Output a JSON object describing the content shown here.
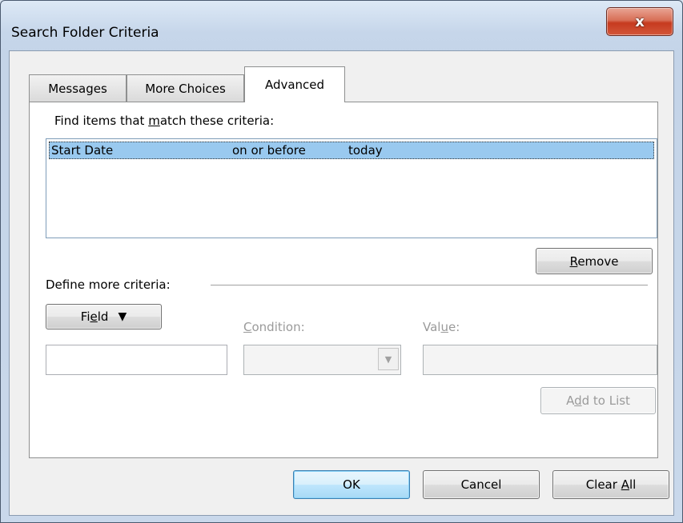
{
  "window": {
    "title": "Search Folder Criteria",
    "close_symbol": "x"
  },
  "tabs": [
    {
      "label": "Messages",
      "active": false
    },
    {
      "label": "More Choices",
      "active": false
    },
    {
      "label": "Advanced",
      "active": true
    }
  ],
  "advanced": {
    "find_label": {
      "before": "Find items that ",
      "accel": "m",
      "after": "atch these criteria:"
    },
    "criteria": [
      {
        "field": "Start Date",
        "condition": "on or before",
        "value": "today",
        "selected": true
      }
    ],
    "remove_button": {
      "accel": "R",
      "after": "emove"
    },
    "define_label": "Define more criteria:",
    "field_button": {
      "before": "Fi",
      "accel": "e",
      "after": "ld",
      "arrow": "▼"
    },
    "condition_label": {
      "accel": "C",
      "after": "ondition:"
    },
    "value_label": {
      "before": "Val",
      "accel": "u",
      "after": "e:"
    },
    "field_value": "",
    "condition_value": "",
    "value_value": "",
    "add_to_list_button": {
      "before": "A",
      "accel": "d",
      "after": "d to List"
    }
  },
  "footer": {
    "ok_label": "OK",
    "cancel_label": "Cancel",
    "clear_all_button": {
      "before": "Clear ",
      "accel": "A",
      "after": "ll"
    }
  }
}
